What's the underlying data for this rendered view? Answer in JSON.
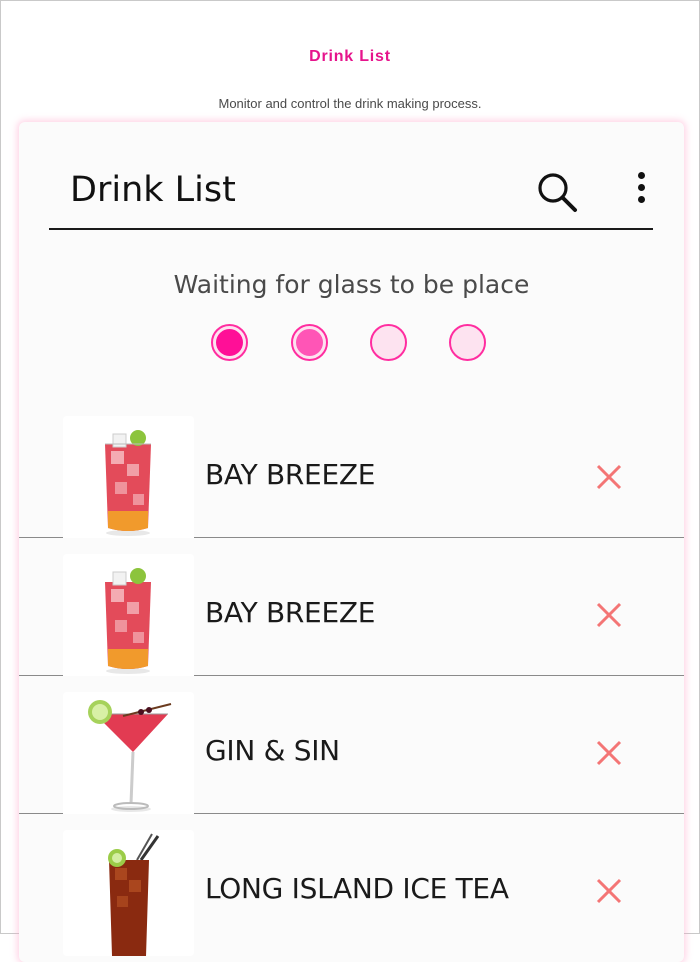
{
  "page": {
    "title": "Drink List",
    "subtitle": "Monitor and control the drink making process."
  },
  "panel": {
    "title": "Drink List",
    "search_icon": "search-icon",
    "more_icon": "more-vertical-icon",
    "status_text": "Waiting for glass to be place",
    "steps": [
      {
        "state": "active",
        "color": "#ff0f97"
      },
      {
        "state": "active",
        "color": "#ff55b6"
      },
      {
        "state": "inactive",
        "color": "#fde3f0"
      },
      {
        "state": "inactive",
        "color": "#fde3f0"
      }
    ]
  },
  "drinks": [
    {
      "name": "BAY BREEZE",
      "image": "highball-red-drink"
    },
    {
      "name": "BAY BREEZE",
      "image": "highball-red-drink"
    },
    {
      "name": "GIN & SIN",
      "image": "martini-red-drink"
    },
    {
      "name": "LONG ISLAND ICE TEA",
      "image": "highball-iced-tea"
    }
  ],
  "colors": {
    "accent": "#e6148c",
    "delete": "#f47575"
  }
}
